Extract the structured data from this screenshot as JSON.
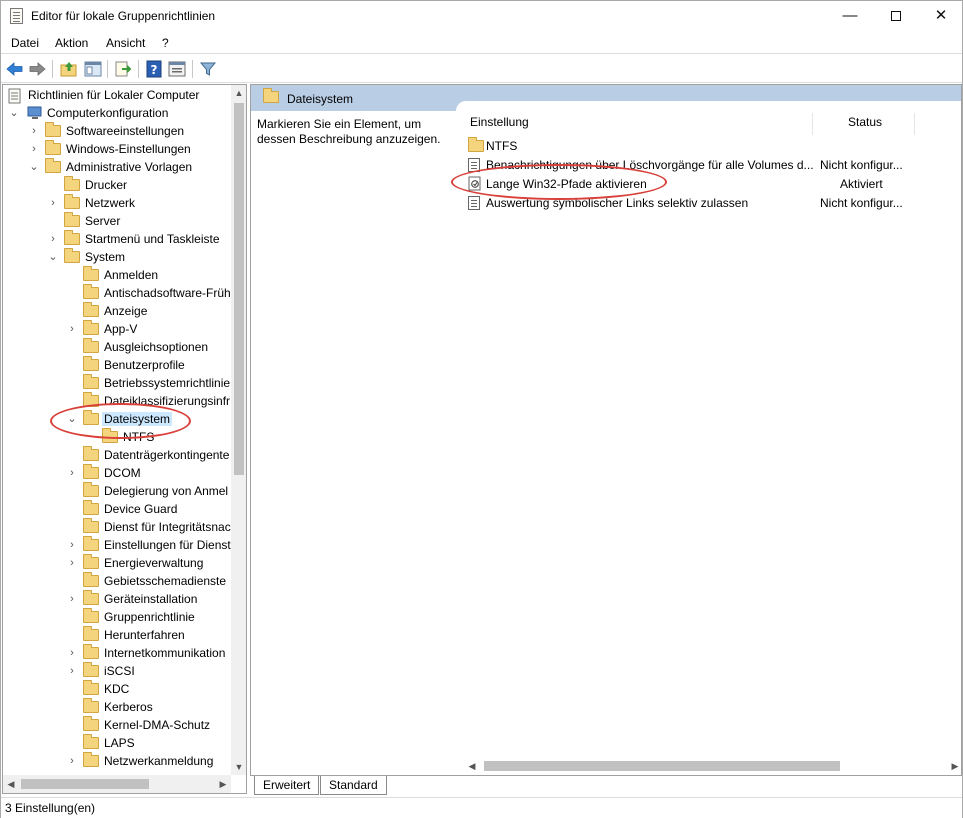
{
  "window": {
    "title": "Editor für lokale Gruppenrichtlinien",
    "minimize": "—",
    "close": "✕"
  },
  "menu": [
    "Datei",
    "Aktion",
    "Ansicht",
    "?"
  ],
  "tree": {
    "items": [
      {
        "label": "Richtlinien für Lokaler Computer"
      },
      {
        "label": "Computerkonfiguration"
      },
      {
        "label": "Softwareeinstellungen"
      },
      {
        "label": "Windows-Einstellungen"
      },
      {
        "label": "Administrative Vorlagen"
      },
      {
        "label": "Drucker"
      },
      {
        "label": "Netzwerk"
      },
      {
        "label": "Server"
      },
      {
        "label": "Startmenü und Taskleiste"
      },
      {
        "label": "System"
      },
      {
        "label": "Anmelden"
      },
      {
        "label": "Antischadsoftware-Früh"
      },
      {
        "label": "Anzeige"
      },
      {
        "label": "App-V"
      },
      {
        "label": "Ausgleichsoptionen"
      },
      {
        "label": "Benutzerprofile"
      },
      {
        "label": "Betriebssystemrichtlinie"
      },
      {
        "label": "Dateiklassifizierungsinfr"
      },
      {
        "label": "Dateisystem"
      },
      {
        "label": "NTFS"
      },
      {
        "label": "Datenträgerkontingente"
      },
      {
        "label": "DCOM"
      },
      {
        "label": "Delegierung von Anmel"
      },
      {
        "label": "Device Guard"
      },
      {
        "label": "Dienst für Integritätsnac"
      },
      {
        "label": "Einstellungen für Dienst"
      },
      {
        "label": "Energieverwaltung"
      },
      {
        "label": "Gebietsschemadienste"
      },
      {
        "label": "Geräteinstallation"
      },
      {
        "label": "Gruppenrichtlinie"
      },
      {
        "label": "Herunterfahren"
      },
      {
        "label": "Internetkommunikation"
      },
      {
        "label": "iSCSI"
      },
      {
        "label": "KDC"
      },
      {
        "label": "Kerberos"
      },
      {
        "label": "Kernel-DMA-Schutz"
      },
      {
        "label": "LAPS"
      },
      {
        "label": "Netzwerkanmeldung"
      }
    ]
  },
  "right": {
    "header": "Dateisystem",
    "description": "Markieren Sie ein Element, um dessen Beschreibung anzuzeigen.",
    "columns": {
      "setting": "Einstellung",
      "status": "Status"
    },
    "rows": [
      {
        "name": "NTFS",
        "status": ""
      },
      {
        "name": "Benachrichtigungen über Löschvorgänge für alle Volumes d...",
        "status": "Nicht konfigur..."
      },
      {
        "name": "Lange Win32-Pfade aktivieren",
        "status": "Aktiviert"
      },
      {
        "name": "Auswertung symbolischer Links selektiv zulassen",
        "status": "Nicht konfigur..."
      }
    ]
  },
  "tabs": [
    "Erweitert",
    "Standard"
  ],
  "status_bar": "3 Einstellung(en)",
  "colors": {
    "header": "#b9cde5",
    "selection": "#cce8ff",
    "annotation": "#d9403a"
  }
}
